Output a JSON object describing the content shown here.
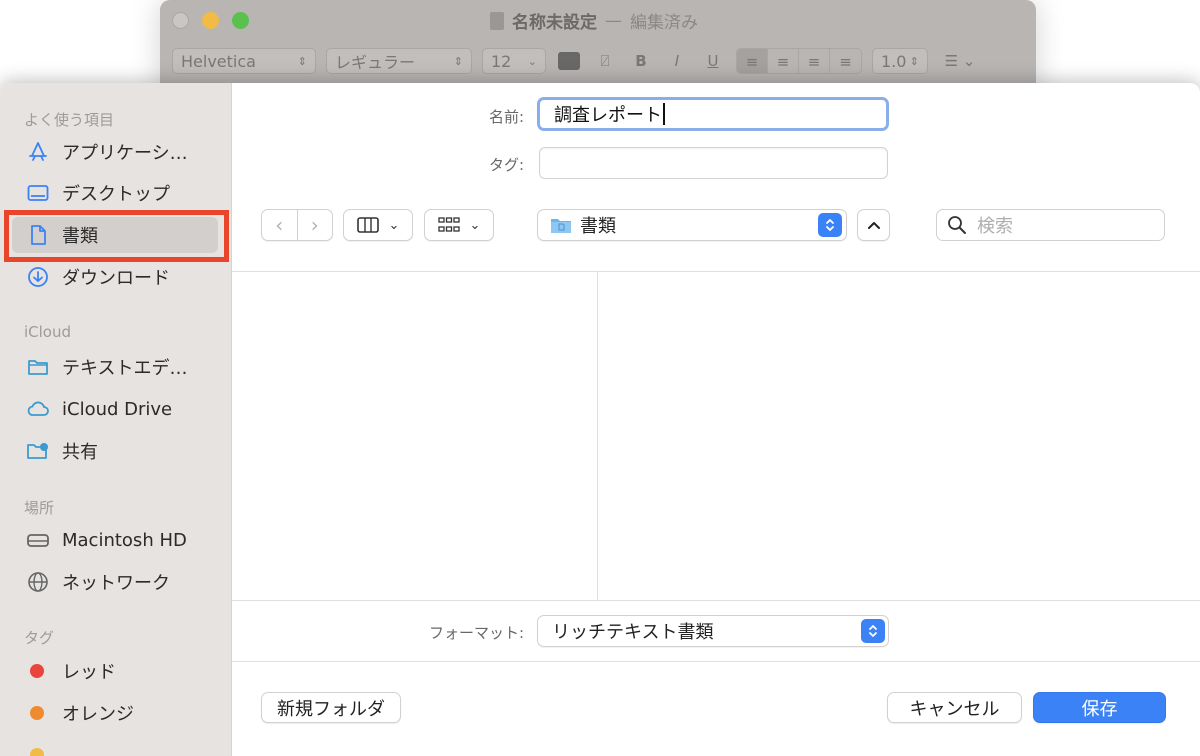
{
  "background_window": {
    "title": "名称未設定",
    "title_separator": "—",
    "title_status": "編集済み",
    "toolbar": {
      "font_family": "Helvetica",
      "font_style": "レギュラー",
      "font_size": "12",
      "bold": "B",
      "italic": "I",
      "underline": "U",
      "line_spacing": "1.0"
    }
  },
  "sidebar": {
    "sections": [
      {
        "title": "よく使う項目"
      },
      {
        "title": "iCloud"
      },
      {
        "title": "場所"
      },
      {
        "title": "タグ"
      }
    ],
    "favorites": [
      {
        "label": "アプリケーシ…",
        "icon": "applications-icon"
      },
      {
        "label": "デスクトップ",
        "icon": "desktop-icon"
      },
      {
        "label": "書類",
        "icon": "document-icon",
        "selected": true
      },
      {
        "label": "ダウンロード",
        "icon": "download-icon"
      }
    ],
    "icloud": [
      {
        "label": "テキストエデ…",
        "icon": "folder-icon"
      },
      {
        "label": "iCloud Drive",
        "icon": "cloud-icon"
      },
      {
        "label": "共有",
        "icon": "shared-folder-icon"
      }
    ],
    "locations": [
      {
        "label": "Macintosh HD",
        "icon": "hard-drive-icon"
      },
      {
        "label": "ネットワーク",
        "icon": "globe-icon"
      }
    ],
    "tags": [
      {
        "label": "レッド",
        "color": "#e8453c"
      },
      {
        "label": "オレンジ",
        "color": "#ee8a30"
      }
    ]
  },
  "form": {
    "name_label": "名前:",
    "name_value": "調査レポート",
    "tag_label": "タグ:",
    "tag_value": ""
  },
  "toolbar": {
    "location": "書類",
    "search_placeholder": "検索"
  },
  "format": {
    "label": "フォーマット:",
    "value": "リッチテキスト書類"
  },
  "buttons": {
    "new_folder": "新規フォルダ",
    "cancel": "キャンセル",
    "save": "保存"
  },
  "colors": {
    "accent": "#3b82f6",
    "highlight": "#e8452a",
    "sidebar_bg": "#e6e3e0"
  }
}
